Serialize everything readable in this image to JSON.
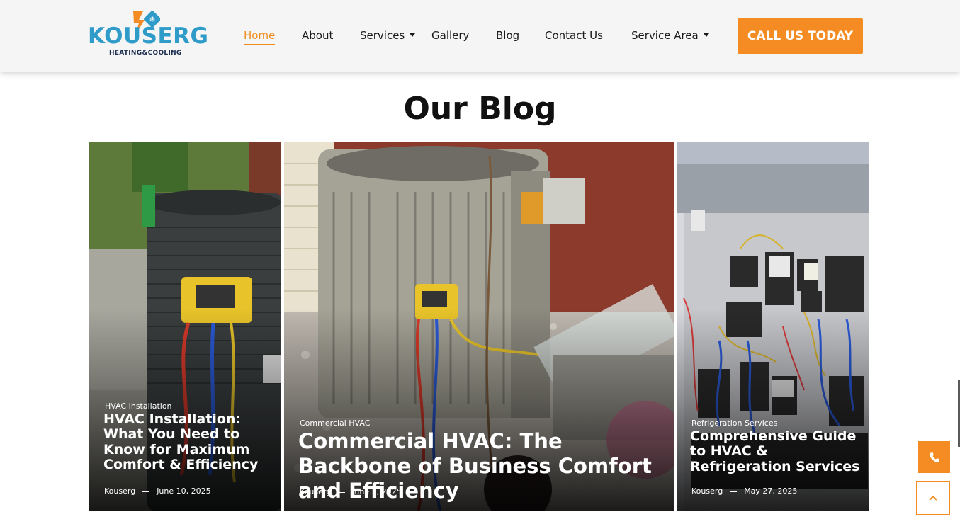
{
  "brand": {
    "name": "KOUSERG",
    "tagline": "HEATING&COOLING",
    "primary_color": "#2e9bc8",
    "accent_color": "#f58c23"
  },
  "nav": {
    "items": [
      {
        "label": "Home",
        "active": true
      },
      {
        "label": "About"
      },
      {
        "label": "Services",
        "dropdown": true
      },
      {
        "label": "Gallery"
      },
      {
        "label": "Blog"
      },
      {
        "label": "Contact Us"
      },
      {
        "label": "Service Area",
        "dropdown": true
      }
    ],
    "cta_label": "CALL US TODAY"
  },
  "section": {
    "title": "Our Blog"
  },
  "posts": [
    {
      "category": "HVAC Installation",
      "title": "HVAC Installation: What You Need to Know for Maximum Comfort & Efficiency",
      "author": "Kouserg",
      "date": "June 10, 2025",
      "image": "hvac-unit-with-manifold-gauge-photo"
    },
    {
      "category": "Commercial HVAC",
      "title": "Commercial HVAC: The Backbone of Business Comfort and Efficiency",
      "author": "Kouserg",
      "date": "June 3, 2025",
      "image": "condenser-unit-beside-brick-wall-photo"
    },
    {
      "category": "Refrigeration Services",
      "title": "Comprehensive Guide to HVAC & Refrigeration Services",
      "author": "Kouserg",
      "date": "May 27, 2025",
      "image": "electrical-control-panel-photo"
    }
  ],
  "floating": {
    "phone_icon": "phone-icon",
    "top_icon": "chevron-up-icon"
  }
}
